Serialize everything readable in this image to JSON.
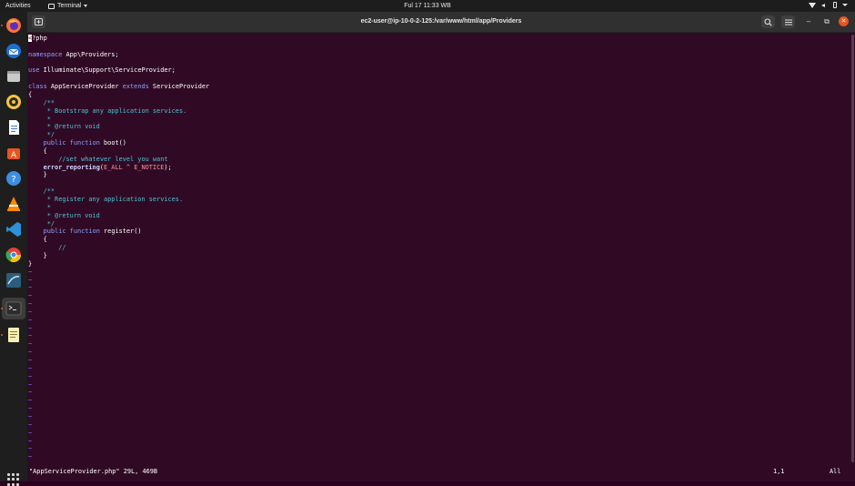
{
  "topbar": {
    "activities": "Activities",
    "app_menu": "Terminal",
    "clock": "Ful 17  11:33 WB"
  },
  "window": {
    "title": "ec2-user@ip-10-0-2-125:/var/www/html/app/Providers"
  },
  "dock": {
    "apps": [
      "firefox-icon",
      "thunderbird-icon",
      "files-icon",
      "rhythmbox-icon",
      "libreoffice-writer-icon",
      "software-center-icon",
      "help-icon",
      "vlc-icon",
      "vscode-icon",
      "chrome-icon",
      "mysql-workbench-icon",
      "terminal-icon",
      "text-editor-icon"
    ],
    "active": "terminal-icon"
  },
  "editor": {
    "code_lines": [
      "<?php",
      "",
      "namespace App\\Providers;",
      "",
      "use Illuminate\\Support\\ServiceProvider;",
      "",
      "class AppServiceProvider extends ServiceProvider",
      "{",
      "    /**",
      "     * Bootstrap any application services.",
      "     *",
      "     * @return void",
      "     */",
      "    public function boot()",
      "    {",
      "        //set whatever level you want",
      "    error_reporting(E_ALL ^ E_NOTICE);",
      "    }",
      "",
      "    /**",
      "     * Register any application services.",
      "     *",
      "     * @return void",
      "     */",
      "    public function register()",
      "    {",
      "        //",
      "    }",
      "}"
    ],
    "status_file": "\"AppServiceProvider.php\" 29L, 469B",
    "status_position": "1,1",
    "status_scroll": "All",
    "empty_marker": "~"
  },
  "colors": {
    "terminal_bg": "#300a24",
    "accent": "#e95420"
  }
}
